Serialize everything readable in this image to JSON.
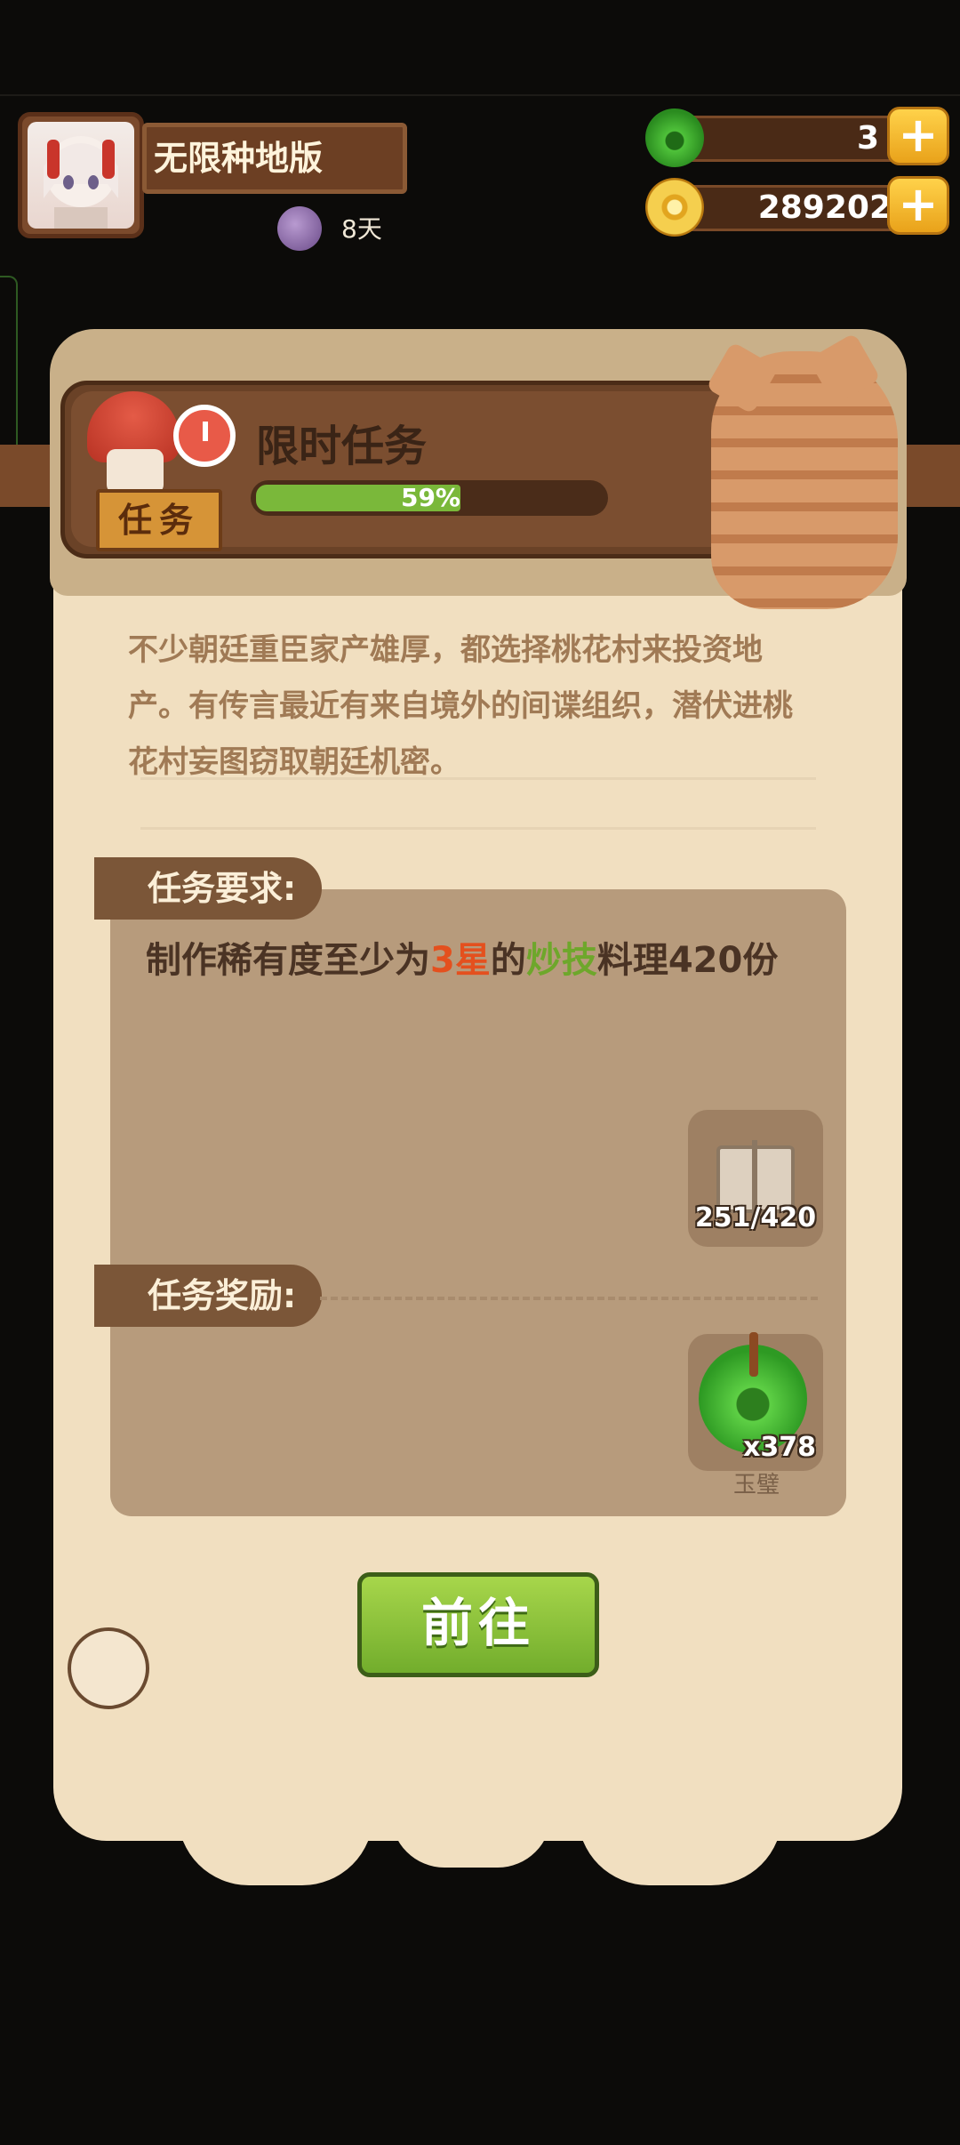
{
  "player": {
    "name": "无限种地版",
    "days": "8天"
  },
  "resources": {
    "jade_count": "3",
    "coin_count": "289202",
    "plus": "+"
  },
  "task_panel": {
    "title": "限时任务",
    "tag": "任务",
    "progress_percent": 59,
    "progress_label": "59%",
    "description": "不少朝廷重臣家产雄厚，都选择桃花村来投资地产。有传言最近有来自境外的间谍组织，潜伏进桃花村妄图窃取朝廷机密。",
    "requirement_header": "任务要求:",
    "requirement": {
      "prefix": "制作稀有度至少为",
      "rarity": "3星",
      "middle": "的",
      "category": "炒技",
      "suffix": "料理420份"
    },
    "requirement_progress": "251/420",
    "reward_header": "任务奖励:",
    "reward_count": "x378",
    "reward_name": "玉璧",
    "go_button": "前往"
  },
  "colors": {
    "highlight_red": "#e4501e",
    "highlight_green": "#6ea72b",
    "progress_green": "#7ab83a",
    "button_green": "#8cc23e"
  }
}
